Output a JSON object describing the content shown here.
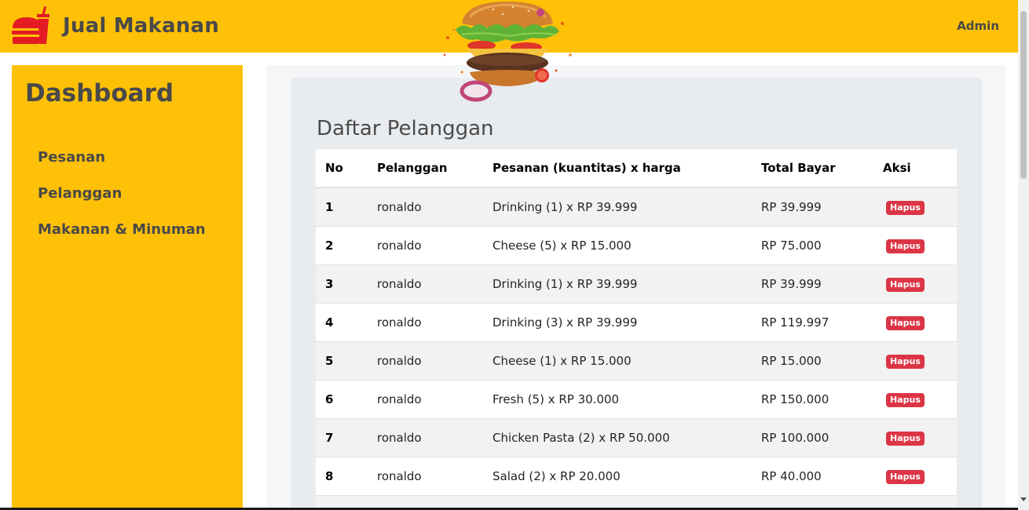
{
  "header": {
    "brand_title": "Jual Makanan",
    "admin_label": "Admin",
    "brand_icon": "fast-food-icon",
    "banner_image": "burger-image"
  },
  "sidebar": {
    "title": "Dashboard",
    "items": [
      {
        "label": "Pesanan"
      },
      {
        "label": "Pelanggan"
      },
      {
        "label": "Makanan & Minuman"
      }
    ]
  },
  "main": {
    "title": "Daftar Pelanggan",
    "columns": [
      "No",
      "Pelanggan",
      "Pesanan (kuantitas) x harga",
      "Total Bayar",
      "Aksi"
    ],
    "rows": [
      {
        "no": "1",
        "pelanggan": "ronaldo",
        "pesanan": "Drinking (1) x RP 39.999",
        "total": "RP 39.999",
        "aksi": "Hapus"
      },
      {
        "no": "2",
        "pelanggan": "ronaldo",
        "pesanan": "Cheese (5) x RP 15.000",
        "total": "RP 75.000",
        "aksi": "Hapus"
      },
      {
        "no": "3",
        "pelanggan": "ronaldo",
        "pesanan": "Drinking (1) x RP 39.999",
        "total": "RP 39.999",
        "aksi": "Hapus"
      },
      {
        "no": "4",
        "pelanggan": "ronaldo",
        "pesanan": "Drinking (3) x RP 39.999",
        "total": "RP 119.997",
        "aksi": "Hapus"
      },
      {
        "no": "5",
        "pelanggan": "ronaldo",
        "pesanan": "Cheese (1) x RP 15.000",
        "total": "RP 15.000",
        "aksi": "Hapus"
      },
      {
        "no": "6",
        "pelanggan": "ronaldo",
        "pesanan": "Fresh (5) x RP 30.000",
        "total": "RP 150.000",
        "aksi": "Hapus"
      },
      {
        "no": "7",
        "pelanggan": "ronaldo",
        "pesanan": "Chicken Pasta (2) x RP 50.000",
        "total": "RP 100.000",
        "aksi": "Hapus"
      },
      {
        "no": "8",
        "pelanggan": "ronaldo",
        "pesanan": "Salad (2) x RP 20.000",
        "total": "RP 40.000",
        "aksi": "Hapus"
      }
    ]
  },
  "colors": {
    "brand_yellow": "#ffc107",
    "text_dark": "#494949",
    "danger": "#dc3545",
    "card_bg": "#e9ecef"
  }
}
